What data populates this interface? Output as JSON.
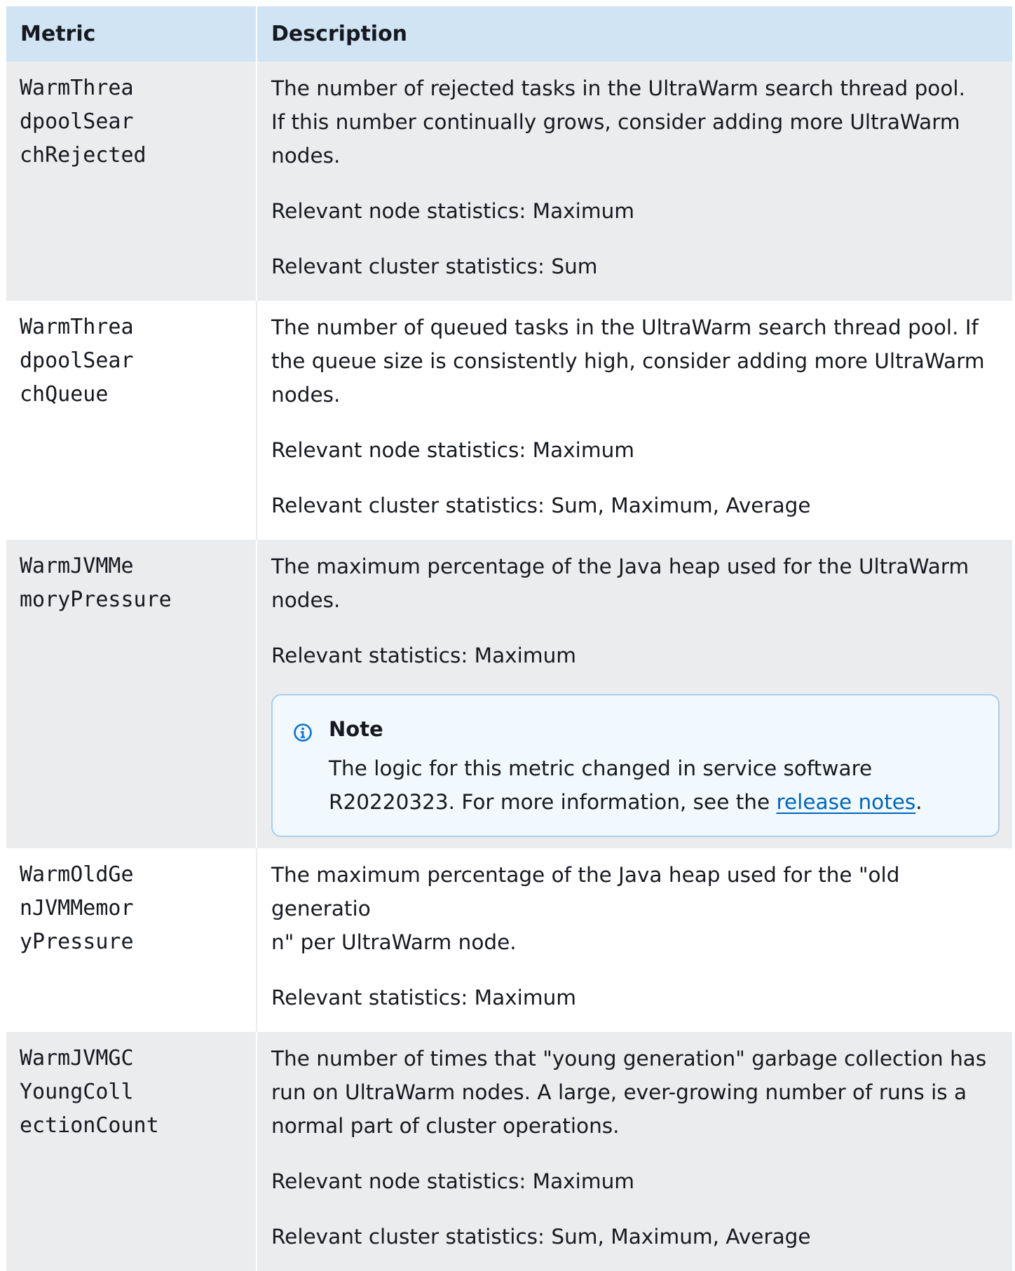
{
  "table": {
    "headers": {
      "metric": "Metric",
      "description": "Description"
    },
    "rows": [
      {
        "metric_lines": "WarmThrea\ndpoolSear\nchRejected",
        "description": "The number of rejected tasks in the UltraWarm search thread pool.\nIf this number continually grows, consider adding more UltraWarm\n nodes.",
        "stat_1": "Relevant node statistics: Maximum",
        "stat_2": "Relevant cluster statistics: Sum"
      },
      {
        "metric_lines": "WarmThrea\ndpoolSear\nchQueue",
        "description": "The number of queued tasks in the UltraWarm search thread pool. If\nthe queue size is consistently high, consider adding more UltraWarm\n nodes.",
        "stat_1": "Relevant node statistics: Maximum",
        "stat_2": "Relevant cluster statistics: Sum, Maximum, Average"
      },
      {
        "metric_lines": "WarmJVMMe\nmoryPressure",
        "description": "The maximum percentage of the Java heap used for the UltraWarm\n nodes.",
        "stat_1": "Relevant statistics: Maximum",
        "note": {
          "title": "Note",
          "icon": "info-icon",
          "text_before": "The logic for this metric changed in service software\nR20220323. For more information, see the ",
          "link": "release notes",
          "text_after": "."
        }
      },
      {
        "metric_lines": "WarmOldGe\nnJVMMemor\nyPressure",
        "description": "The maximum percentage of the Java heap used for the \"old generatio\nn\" per UltraWarm node.",
        "stat_1": "Relevant statistics: Maximum"
      },
      {
        "metric_lines": "WarmJVMGC\nYoungColl\nectionCount",
        "description": "The number of times that \"young generation\" garbage collection has\nrun on UltraWarm nodes. A large, ever-growing number of runs is a\nnormal part of cluster operations.",
        "stat_1": "Relevant node statistics: Maximum",
        "stat_2": "Relevant cluster statistics: Sum, Maximum, Average"
      }
    ]
  },
  "colors": {
    "header_bg": "#d1e4f4",
    "row_shaded_bg": "#ebecee",
    "note_bg": "#f1f8fe",
    "note_border": "#a9cfee",
    "link": "#0066b8"
  }
}
